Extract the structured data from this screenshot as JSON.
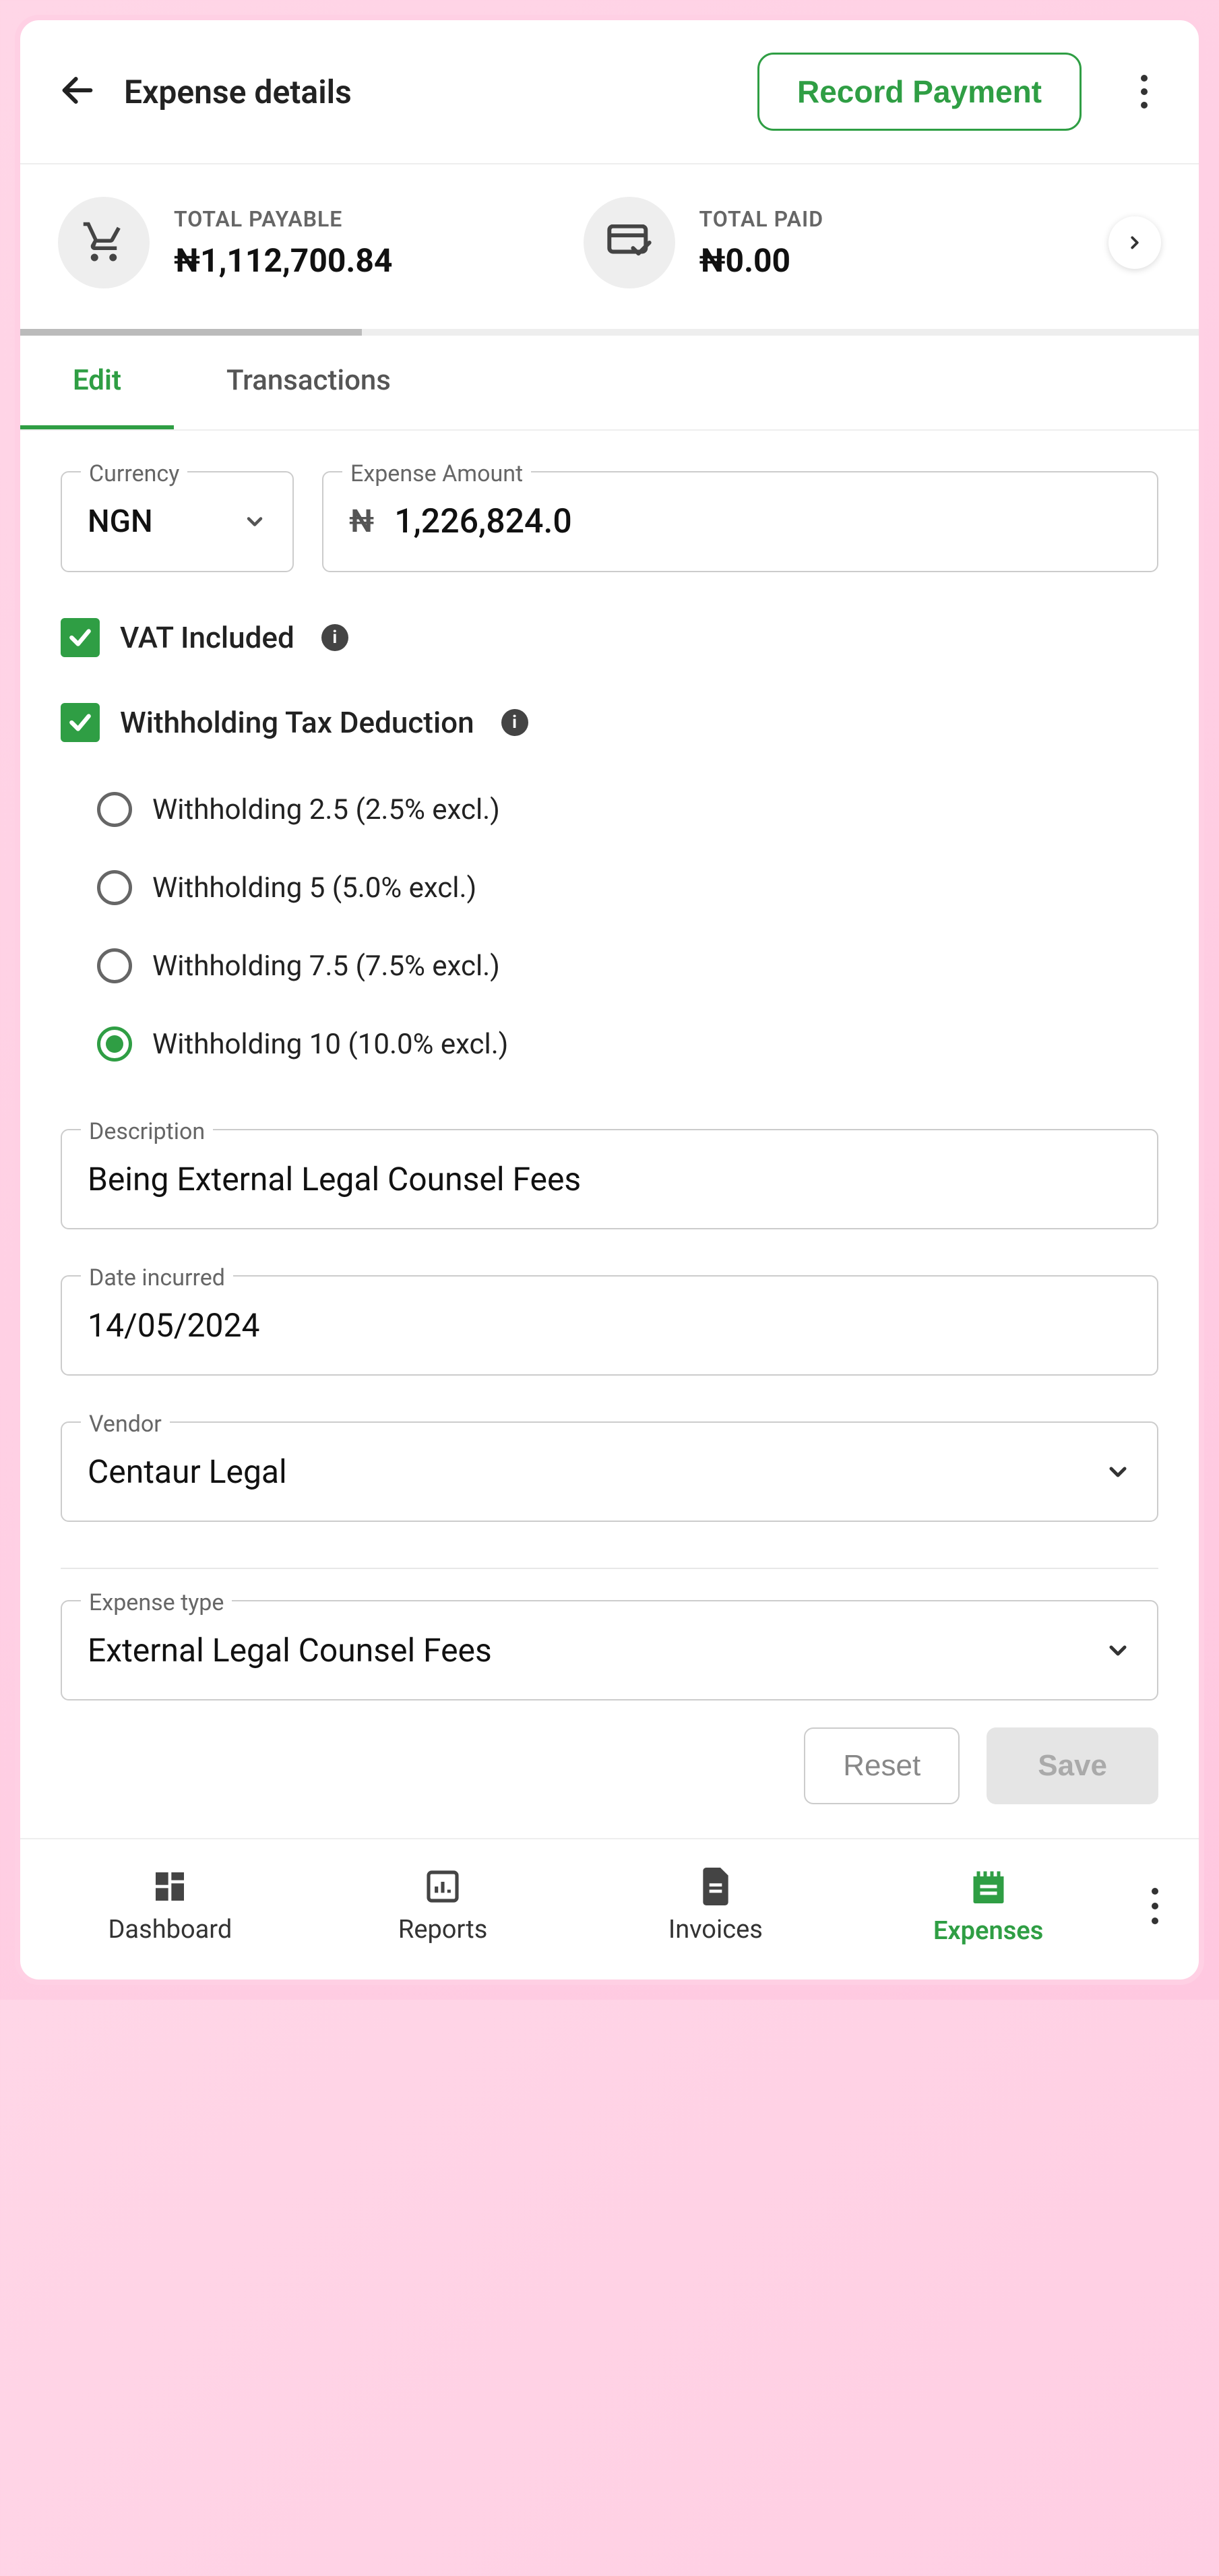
{
  "header": {
    "title": "Expense details",
    "record_payment": "Record Payment"
  },
  "summary": {
    "payable_label": "TOTAL PAYABLE",
    "payable_value": "₦1,112,700.84",
    "paid_label": "TOTAL PAID",
    "paid_value": "₦0.00"
  },
  "tabs": {
    "edit": "Edit",
    "transactions": "Transactions"
  },
  "form": {
    "currency_label": "Currency",
    "currency_value": "NGN",
    "amount_label": "Expense Amount",
    "amount_symbol": "₦",
    "amount_value": "1,226,824.0",
    "vat_label": "VAT Included",
    "wht_label": "Withholding Tax Deduction",
    "wht_options": [
      "Withholding 2.5 (2.5% excl.)",
      "Withholding 5 (5.0% excl.)",
      "Withholding 7.5 (7.5% excl.)",
      "Withholding 10 (10.0% excl.)"
    ],
    "wht_selected_index": 3,
    "description_label": "Description",
    "description_value": "Being External Legal Counsel Fees",
    "date_label": "Date incurred",
    "date_value": "14/05/2024",
    "vendor_label": "Vendor",
    "vendor_value": "Centaur Legal",
    "expense_type_label": "Expense type",
    "expense_type_value": "External Legal Counsel Fees"
  },
  "buttons": {
    "reset": "Reset",
    "save": "Save"
  },
  "nav": {
    "dashboard": "Dashboard",
    "reports": "Reports",
    "invoices": "Invoices",
    "expenses": "Expenses"
  }
}
